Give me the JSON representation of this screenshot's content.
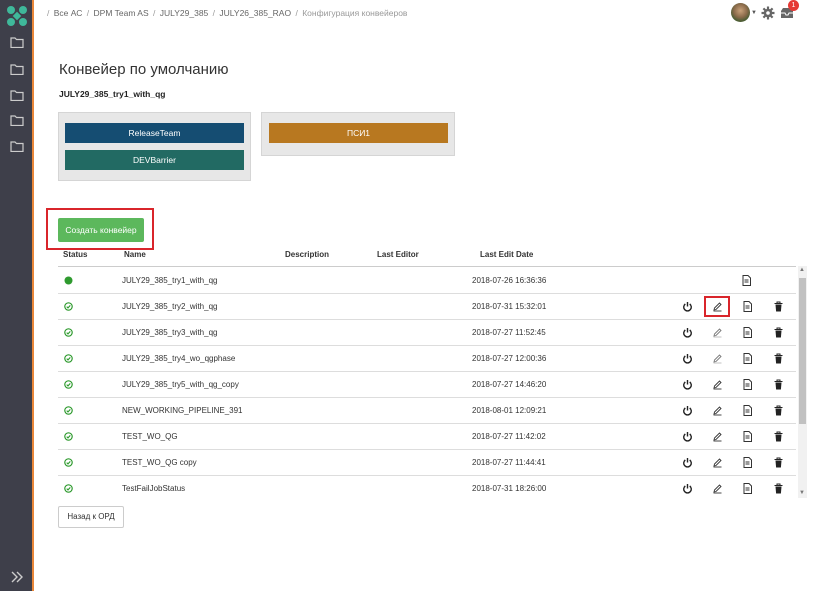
{
  "breadcrumb": {
    "items": [
      "Все АС",
      "DPM Team AS",
      "JULY29_385",
      "JULY26_385_RAO"
    ],
    "current": "Конфигурация конвейеров",
    "separator": "/"
  },
  "header": {
    "notification_count": "1"
  },
  "page": {
    "title": "Конвейер по умолчанию",
    "subtitle": "JULY29_385_try1_with_qg"
  },
  "stages": {
    "group1": [
      {
        "label": "ReleaseTeam",
        "color": "#154d72"
      },
      {
        "label": "DEVBarrier",
        "color": "#226a63"
      }
    ],
    "group2": [
      {
        "label": "ПСИ1",
        "color": "#b87820"
      }
    ]
  },
  "create_button": "Создать конвейер",
  "table": {
    "headers": [
      "Status",
      "Name",
      "Description",
      "Last Editor",
      "Last Edit Date"
    ],
    "rows": [
      {
        "status": "active",
        "name": "JULY29_385_try1_with_qg",
        "date": "2018-07-26 16:36:36",
        "default": true
      },
      {
        "status": "ok",
        "name": "JULY29_385_try2_with_qg",
        "date": "2018-07-31 15:32:01",
        "default": false
      },
      {
        "status": "ok",
        "name": "JULY29_385_try3_with_qg",
        "date": "2018-07-27 11:52:45",
        "default": false
      },
      {
        "status": "ok",
        "name": "JULY29_385_try4_wo_qgphase",
        "date": "2018-07-27 12:00:36",
        "default": false
      },
      {
        "status": "ok",
        "name": "JULY29_385_try5_with_qg_copy",
        "date": "2018-07-27 14:46:20",
        "default": false
      },
      {
        "status": "ok",
        "name": "NEW_WORKING_PIPELINE_391",
        "date": "2018-08-01 12:09:21",
        "default": false
      },
      {
        "status": "ok",
        "name": "TEST_WO_QG",
        "date": "2018-07-27 11:42:02",
        "default": false
      },
      {
        "status": "ok",
        "name": "TEST_WO_QG copy",
        "date": "2018-07-27 11:44:41",
        "default": false
      },
      {
        "status": "ok",
        "name": "TestFailJobStatus",
        "date": "2018-07-31 18:26:00",
        "default": false
      }
    ]
  },
  "back_button": "Назад к ОРД",
  "colors": {
    "accent": "#e8873a",
    "success": "#2e9a2e",
    "highlight": "#d9252b",
    "sidebar": "#3e3f4a"
  }
}
